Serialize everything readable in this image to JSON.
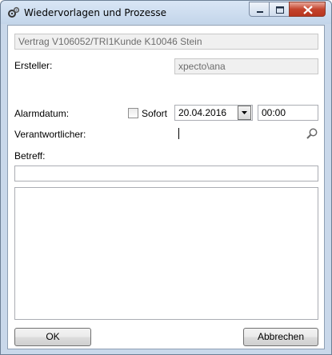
{
  "window": {
    "title": "Wiedervorlagen und Prozesse"
  },
  "form": {
    "subject_ref": "Vertrag V106052/TRI1Kunde K10046 Stein",
    "creator_label": "Ersteller:",
    "creator_value": "xpecto\\ana",
    "alarm_label": "Alarmdatum:",
    "immediate_label": "Sofort",
    "immediate_checked": false,
    "alarm_date": "20.04.2016",
    "alarm_time": "00:00",
    "responsible_label": "Verantwortlicher:",
    "responsible_value": "",
    "subject_label": "Betreff:",
    "subject_value": "",
    "notes_value": ""
  },
  "buttons": {
    "ok": "OK",
    "cancel": "Abbrechen"
  },
  "icons": {
    "app": "gears-icon",
    "search": "search-icon",
    "dropdown": "chevron-down-icon",
    "minimize": "minimize-icon",
    "maximize": "maximize-icon",
    "close": "close-icon"
  },
  "colors": {
    "title_bar": "#c9d8ea",
    "close_button": "#c4442d",
    "readonly_bg": "#f0f0f0"
  }
}
